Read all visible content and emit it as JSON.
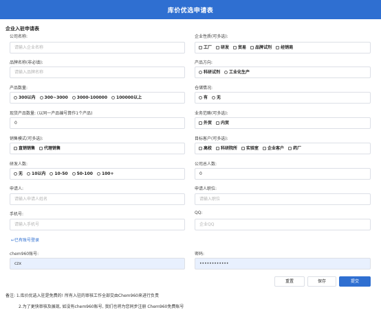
{
  "header": {
    "title": "库价优选申请表"
  },
  "form": {
    "section_title": "企业入驻申请表",
    "company_name": {
      "label": "公司名称:",
      "placeholder": "请输入企业名称"
    },
    "company_type": {
      "label": "企业性质(可多选):",
      "options": [
        "工厂",
        "研发",
        "贸易",
        "品牌试剂",
        "经销商"
      ]
    },
    "brand_name": {
      "label": "品牌名称(非必填):",
      "placeholder": "请输入品牌名称"
    },
    "product_direction": {
      "label": "产品方向:",
      "options": [
        "科研试剂",
        "工业化生产"
      ]
    },
    "product_count": {
      "label": "产品数量:",
      "options": [
        "300以内",
        "300~3000",
        "3000-100000",
        "100000以上"
      ]
    },
    "warehouse": {
      "label": "仓储情况:",
      "options": [
        "有",
        "无"
      ]
    },
    "stock_count": {
      "label": "现货产品数量: (以同一产品编号算作1个产品)",
      "value": "0"
    },
    "business_scope": {
      "label": "业务范畴(可多选):",
      "options": [
        "外贸",
        "内贸"
      ]
    },
    "sales_mode": {
      "label": "销售模式(可多选):",
      "options": [
        "直销销售",
        "代理销售"
      ]
    },
    "target_customers": {
      "label": "目标客户(可多选):",
      "options": [
        "高校",
        "科研院所",
        "实验室",
        "企业客户",
        "药厂"
      ]
    },
    "rd_staff": {
      "label": "研发人数:",
      "options": [
        "无",
        "10以内",
        "10-50",
        "50-100",
        "100+"
      ]
    },
    "total_staff": {
      "label": "公司总人数:",
      "value": "0"
    },
    "applicant": {
      "label": "申请人:",
      "placeholder": "请输入申请人姓名"
    },
    "applicant_position": {
      "label": "申请人职位:",
      "placeholder": "请输入职位"
    },
    "phone": {
      "label": "手机号:",
      "placeholder": "请输入手机号"
    },
    "qq": {
      "label": "QQ:",
      "placeholder": "企业QQ"
    },
    "existing_account_link": "↩已有账号登录",
    "account": {
      "label": "chem960账号:",
      "value": "czx"
    },
    "password": {
      "label": "密码:",
      "value": "••••••••••••"
    }
  },
  "buttons": {
    "reset": "重置",
    "save": "保存",
    "submit": "提交"
  },
  "notes": {
    "line1": "备注: 1.库价优选入驻是免费的! 所有入驻的审核工作全部交由Chem960来进行负责",
    "line2": "2.为了更快审核及展现, 如没有chem960账号, 我们也将为您同步注册 Chem960免费账号"
  },
  "colors": {
    "brand": "#2f6fd1",
    "autofill": "#e8f0fe"
  }
}
